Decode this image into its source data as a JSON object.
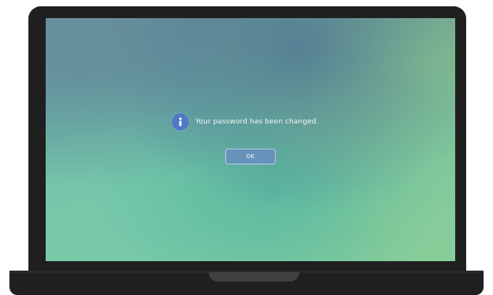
{
  "dialog": {
    "message": "Your password has been changed.",
    "ok_label": "OK",
    "icon": "info-icon"
  },
  "colors": {
    "bezel": "#1f1f1f",
    "info_icon_bg": "#4f79c6",
    "button_bg": "#688fbe",
    "button_border": "#cde2f5"
  }
}
